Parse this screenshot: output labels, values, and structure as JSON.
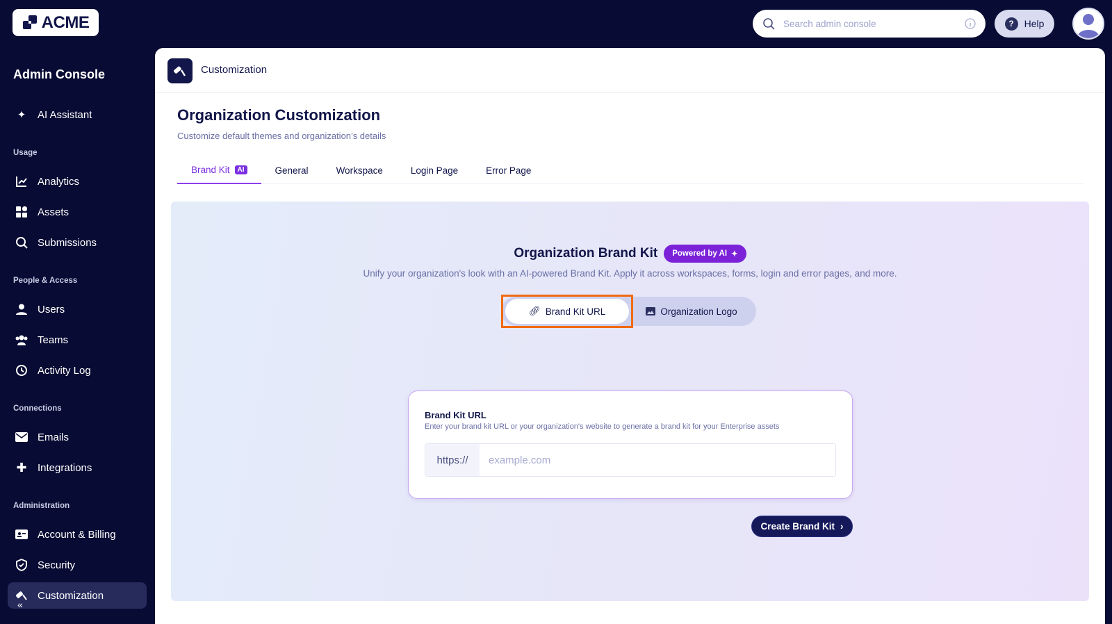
{
  "brand": {
    "logo_text": "ACME"
  },
  "sidebar": {
    "title": "Admin Console",
    "ai_assistant": "AI Assistant",
    "sections": [
      {
        "label": "Usage",
        "items": [
          "Analytics",
          "Assets",
          "Submissions"
        ]
      },
      {
        "label": "People & Access",
        "items": [
          "Users",
          "Teams",
          "Activity Log"
        ]
      },
      {
        "label": "Connections",
        "items": [
          "Emails",
          "Integrations"
        ]
      },
      {
        "label": "Administration",
        "items": [
          "Account & Billing",
          "Security",
          "Customization"
        ]
      }
    ],
    "active": "Customization"
  },
  "topbar": {
    "search_placeholder": "Search admin console",
    "help_label": "Help"
  },
  "panel": {
    "header_title": "Customization",
    "title": "Organization Customization",
    "subtitle": "Customize default themes and organization’s details",
    "tabs": [
      {
        "label": "Brand Kit",
        "badge": "AI"
      },
      {
        "label": "General"
      },
      {
        "label": "Workspace"
      },
      {
        "label": "Login Page"
      },
      {
        "label": "Error Page"
      }
    ],
    "active_tab": "Brand Kit"
  },
  "brandkit": {
    "title": "Organization Brand Kit",
    "pill": "Powered by AI",
    "description": "Unify your organization's look with an AI-powered Brand Kit. Apply it across workspaces, forms, login and error pages, and more.",
    "toggle": {
      "option1": "Brand Kit URL",
      "option2": "Organization Logo",
      "selected": "Brand Kit URL"
    },
    "card": {
      "label": "Brand Kit URL",
      "description": "Enter your brand kit URL or your organization's website to generate a brand kit for your Enterprise assets",
      "prefix": "https://",
      "placeholder": "example.com",
      "value": ""
    },
    "create_button": "Create Brand Kit"
  },
  "colors": {
    "sidebar_bg": "#080b33",
    "accent": "#7b2fe0",
    "highlight": "#f26a10",
    "button": "#15195a"
  }
}
